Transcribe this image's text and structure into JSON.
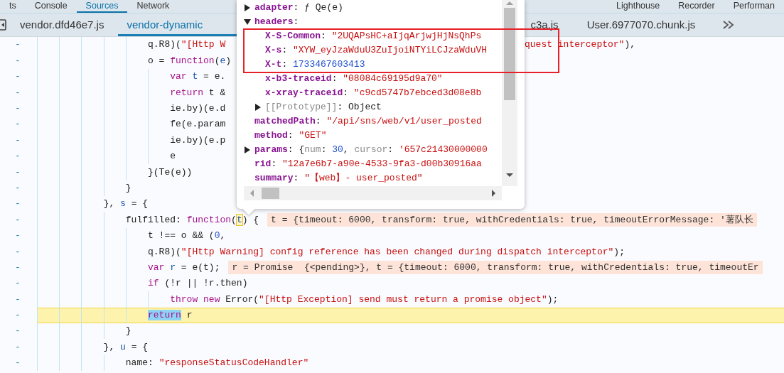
{
  "panel_tabs": [
    {
      "label": "ts",
      "selected": false
    },
    {
      "label": "Console",
      "selected": false
    },
    {
      "label": "Sources",
      "selected": true
    },
    {
      "label": "Network",
      "selected": false
    },
    {
      "label": "Lighthouse",
      "selected": false
    },
    {
      "label": "Recorder",
      "selected": false
    },
    {
      "label": "Performan",
      "selected": false
    }
  ],
  "file_tabs": [
    {
      "label": "vendor.dfd46e7.js",
      "selected": false
    },
    {
      "label": "vendor-dynamic",
      "selected": true
    },
    {
      "label": "c3a.js",
      "selected": false
    },
    {
      "label": "User.6977070.chunk.js",
      "selected": false
    }
  ],
  "code_lines": [
    {
      "gutter": "-",
      "current": false,
      "tokens": [
        {
          "kind": "plain",
          "text": "                    q.R8)("
        },
        {
          "kind": "string",
          "text": "\"[Http W"
        }
      ],
      "right_tokens": [
        {
          "kind": "string",
          "text": "quest interceptor\""
        },
        {
          "kind": "plain",
          "text": "),"
        }
      ]
    },
    {
      "gutter": "-",
      "current": false,
      "tokens": [
        {
          "kind": "plain",
          "text": "                    o = "
        },
        {
          "kind": "keyword",
          "text": "function"
        },
        {
          "kind": "plain",
          "text": "("
        },
        {
          "kind": "variable",
          "text": "e"
        },
        {
          "kind": "plain",
          "text": ")"
        }
      ]
    },
    {
      "gutter": "-",
      "current": false,
      "tokens": [
        {
          "kind": "keyword",
          "text": "                        var "
        },
        {
          "kind": "variable",
          "text": "t"
        },
        {
          "kind": "plain",
          "text": " = e."
        }
      ]
    },
    {
      "gutter": "-",
      "current": false,
      "tokens": [
        {
          "kind": "keyword",
          "text": "                        return"
        },
        {
          "kind": "plain",
          "text": " t &"
        }
      ]
    },
    {
      "gutter": "-",
      "current": false,
      "tokens": [
        {
          "kind": "plain",
          "text": "                        ie.by)(e.d"
        }
      ]
    },
    {
      "gutter": "-",
      "current": false,
      "tokens": [
        {
          "kind": "plain",
          "text": "                        fe(e.param"
        }
      ]
    },
    {
      "gutter": "-",
      "current": false,
      "tokens": [
        {
          "kind": "plain",
          "text": "                        ie.by)(e.p"
        }
      ]
    },
    {
      "gutter": "-",
      "current": false,
      "tokens": [
        {
          "kind": "plain",
          "text": "                        e"
        }
      ]
    },
    {
      "gutter": "-",
      "current": false,
      "tokens": [
        {
          "kind": "plain",
          "text": "                    }(Te(e))"
        }
      ]
    },
    {
      "gutter": "-",
      "current": false,
      "tokens": [
        {
          "kind": "plain",
          "text": "                }"
        }
      ]
    },
    {
      "gutter": "-",
      "current": false,
      "tokens": [
        {
          "kind": "plain",
          "text": "            }, "
        },
        {
          "kind": "variable",
          "text": "s"
        },
        {
          "kind": "plain",
          "text": " = {"
        }
      ]
    },
    {
      "gutter": "-",
      "current": false,
      "tokens": [
        {
          "kind": "plain",
          "text": "                fulfilled: "
        },
        {
          "kind": "keyword",
          "text": "function"
        },
        {
          "kind": "plain",
          "text": "("
        },
        {
          "kind": "param-hover",
          "text": "t"
        },
        {
          "kind": "plain",
          "text": ") {"
        }
      ],
      "inline_value": "t = {timeout: 6000, transform: true, withCredentials: true, timeoutErrorMessage: '薯队长"
    },
    {
      "gutter": "-",
      "current": false,
      "tokens": [
        {
          "kind": "plain",
          "text": "                    t !== o && ("
        },
        {
          "kind": "number",
          "text": "0"
        },
        {
          "kind": "plain",
          "text": ","
        }
      ]
    },
    {
      "gutter": "-",
      "current": false,
      "tokens": [
        {
          "kind": "plain",
          "text": "                    q.R8)("
        },
        {
          "kind": "string",
          "text": "\"[Http Warning] config reference has been changed during dispatch interceptor\""
        },
        {
          "kind": "plain",
          "text": ");"
        }
      ]
    },
    {
      "gutter": "-",
      "current": false,
      "tokens": [
        {
          "kind": "keyword",
          "text": "                    var "
        },
        {
          "kind": "variable",
          "text": "r"
        },
        {
          "kind": "plain",
          "text": " = e(t);"
        }
      ],
      "inline_value": "r = Promise  {<pending>}, t = {timeout: 6000, transform: true, withCredentials: true, timeoutEr"
    },
    {
      "gutter": "-",
      "current": false,
      "tokens": [
        {
          "kind": "keyword",
          "text": "                    if"
        },
        {
          "kind": "plain",
          "text": " (!r || !r.then)"
        }
      ]
    },
    {
      "gutter": "-",
      "current": false,
      "tokens": [
        {
          "kind": "keyword",
          "text": "                        throw new"
        },
        {
          "kind": "plain",
          "text": " Error("
        },
        {
          "kind": "string",
          "text": "\"[Http Exception] send must return a promise object\""
        },
        {
          "kind": "plain",
          "text": ");"
        }
      ]
    },
    {
      "gutter": "-",
      "current": true,
      "tokens": [
        {
          "kind": "keyword-selected",
          "text": "                    return"
        },
        {
          "kind": "plain",
          "text": " r"
        }
      ]
    },
    {
      "gutter": "-",
      "current": false,
      "tokens": [
        {
          "kind": "plain",
          "text": "                }"
        }
      ]
    },
    {
      "gutter": "-",
      "current": false,
      "tokens": [
        {
          "kind": "plain",
          "text": "            }, "
        },
        {
          "kind": "variable",
          "text": "u"
        },
        {
          "kind": "plain",
          "text": " = {"
        }
      ]
    },
    {
      "gutter": "-",
      "current": false,
      "tokens": [
        {
          "kind": "plain",
          "text": "                name: "
        },
        {
          "kind": "string",
          "text": "\"responseStatusCodeHandler\""
        }
      ]
    }
  ],
  "popover": {
    "rows": [
      {
        "kind": "object",
        "expanded": false,
        "key": "adapter",
        "value": [
          {
            "kind": "plain",
            "text": ": ƒ Qe(e)"
          }
        ]
      },
      {
        "kind": "object",
        "expanded": true,
        "key": "headers",
        "value": [
          {
            "kind": "plain",
            "text": ":"
          }
        ],
        "children": [
          {
            "kind": "value",
            "key": "X-S-Common",
            "highlighted": true,
            "value": [
              {
                "kind": "plain",
                "text": ": "
              },
              {
                "kind": "string",
                "text": "\"2UQAPsHC+aIjqArjwjHjNsQhPs"
              }
            ]
          },
          {
            "kind": "value",
            "key": "X-s",
            "highlighted": true,
            "value": [
              {
                "kind": "plain",
                "text": ": "
              },
              {
                "kind": "string",
                "text": "\"XYW_eyJzaWduU3ZuIjoiNTYiLCJzaWduVH"
              }
            ]
          },
          {
            "kind": "value",
            "key": "X-t",
            "highlighted": true,
            "value": [
              {
                "kind": "plain",
                "text": ": "
              },
              {
                "kind": "number",
                "text": "1733467603413"
              }
            ]
          },
          {
            "kind": "value",
            "key": "x-b3-traceid",
            "highlighted": false,
            "value": [
              {
                "kind": "plain",
                "text": ": "
              },
              {
                "kind": "string",
                "text": "\"08084c69195d9a70\""
              }
            ]
          },
          {
            "kind": "value",
            "key": "x-xray-traceid",
            "highlighted": false,
            "value": [
              {
                "kind": "plain",
                "text": ": "
              },
              {
                "kind": "string",
                "text": "\"c9cd5747b7ebced3d08e8b"
              }
            ]
          },
          {
            "kind": "internal-object",
            "expanded": false,
            "highlighted": false,
            "key": "[[Prototype]]",
            "value": [
              {
                "kind": "plain",
                "text": ": Object"
              }
            ]
          }
        ]
      },
      {
        "kind": "value",
        "key": "matchedPath",
        "value": [
          {
            "kind": "plain",
            "text": ": "
          },
          {
            "kind": "string",
            "text": "\"/api/sns/web/v1/user_posted"
          }
        ]
      },
      {
        "kind": "value",
        "key": "method",
        "value": [
          {
            "kind": "plain",
            "text": ": "
          },
          {
            "kind": "string",
            "text": "\"GET\""
          }
        ]
      },
      {
        "kind": "object",
        "expanded": false,
        "key": "params",
        "value": [
          {
            "kind": "plain",
            "text": ": {"
          },
          {
            "kind": "dim",
            "text": "num"
          },
          {
            "kind": "plain",
            "text": ": "
          },
          {
            "kind": "number",
            "text": "30"
          },
          {
            "kind": "plain",
            "text": ", "
          },
          {
            "kind": "dim",
            "text": "cursor"
          },
          {
            "kind": "plain",
            "text": ": "
          },
          {
            "kind": "string",
            "text": "'657c21430000000"
          }
        ]
      },
      {
        "kind": "value",
        "key": "rid",
        "value": [
          {
            "kind": "plain",
            "text": ": "
          },
          {
            "kind": "string",
            "text": "\"12a7e6b7-a90e-4533-9fa3-d00b30916aa"
          }
        ]
      },
      {
        "kind": "value",
        "key": "summary",
        "value": [
          {
            "kind": "plain",
            "text": ": "
          },
          {
            "kind": "string",
            "text": "\"【web】- user_posted\""
          }
        ]
      }
    ]
  }
}
